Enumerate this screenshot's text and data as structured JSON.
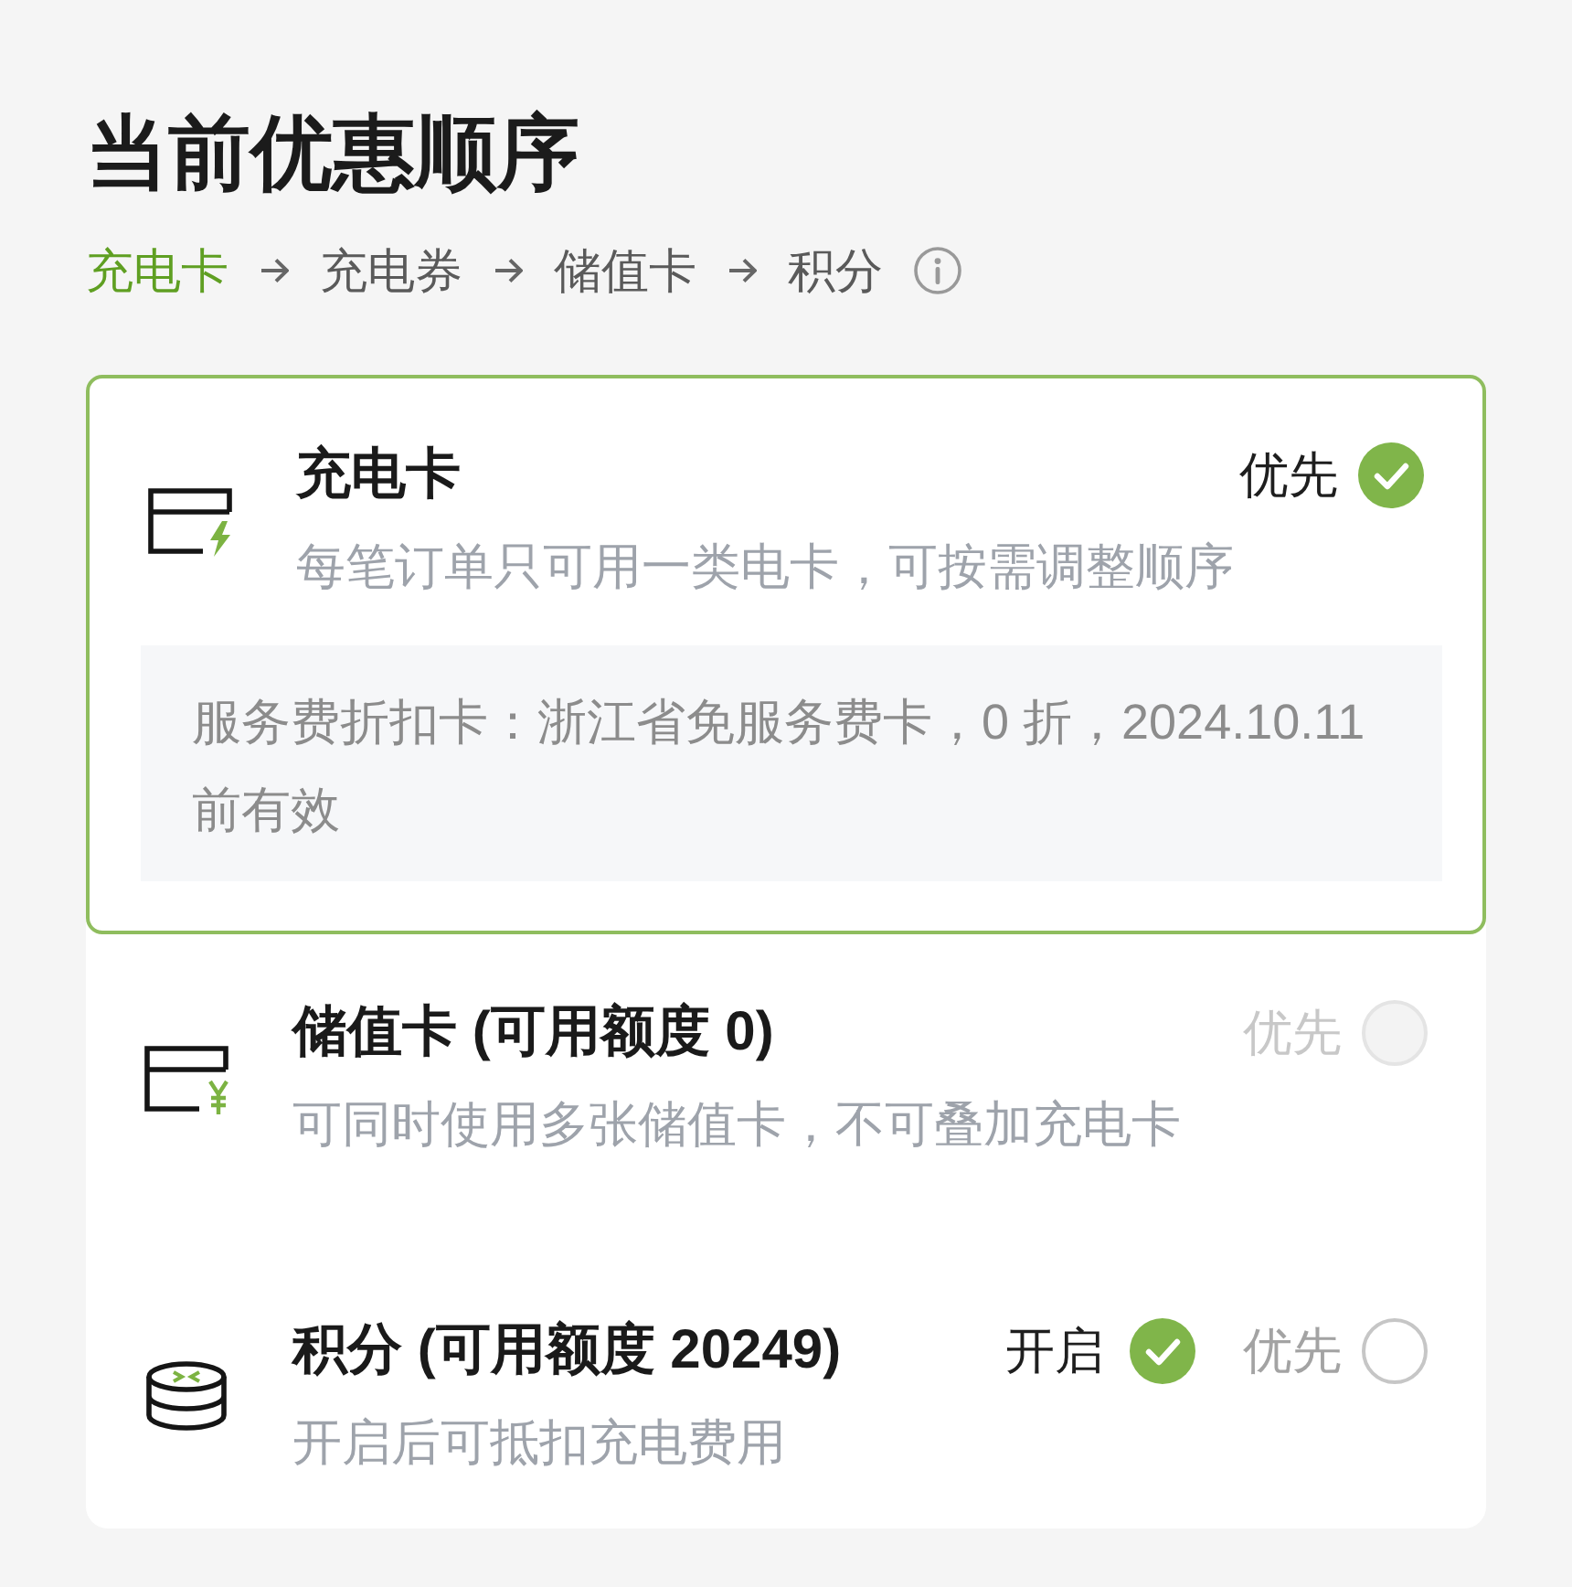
{
  "title": "当前优惠顺序",
  "order": {
    "steps": [
      {
        "label": "充电卡",
        "highlighted": true
      },
      {
        "label": "充电券",
        "highlighted": false
      },
      {
        "label": "储值卡",
        "highlighted": false
      },
      {
        "label": "积分",
        "highlighted": false
      }
    ]
  },
  "items": [
    {
      "kind": "charge_card",
      "title": "充电卡",
      "description": "每笔订单只可用一类电卡，可按需调整顺序",
      "priority": {
        "label": "优先",
        "selected": true,
        "disabled": false
      },
      "detail": "服务费折扣卡：浙江省免服务费卡，0 折，2024.10.11前有效"
    },
    {
      "kind": "stored_value",
      "title": "储值卡 (可用额度 0)",
      "description": "可同时使用多张储值卡，不可叠加充电卡",
      "priority": {
        "label": "优先",
        "selected": false,
        "disabled": true
      }
    },
    {
      "kind": "points",
      "title": "积分 (可用额度 20249)",
      "description": "开启后可抵扣充电费用",
      "toggle": {
        "label": "开启",
        "checked": true
      },
      "priority": {
        "label": "优先",
        "selected": false,
        "disabled": false
      }
    }
  ]
}
